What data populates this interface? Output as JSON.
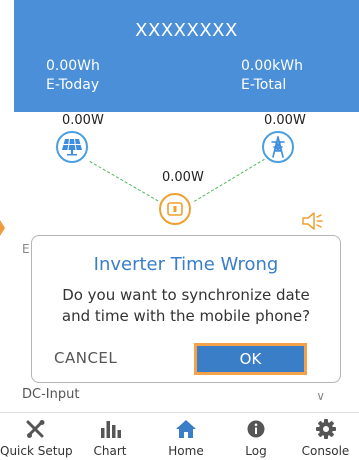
{
  "header": {
    "title": "XXXXXXXX",
    "today_value": "0.00Wh",
    "today_label": "E-Today",
    "total_value": "0.00kWh",
    "total_label": "E-Total"
  },
  "flow": {
    "pv_power": "0.00W",
    "grid_power": "0.00W",
    "inverter_power": "0.00W"
  },
  "dialog": {
    "title": "Inverter Time Wrong",
    "message_line1": "Do you want to synchronize date",
    "message_line2": "and time with the mobile phone?",
    "cancel_label": "CANCEL",
    "ok_label": "OK"
  },
  "partial_label": "E",
  "dc_input": {
    "label": "DC-Input",
    "chevron": "∨"
  },
  "tabbar": {
    "items": [
      {
        "label": "Quick Setup",
        "icon": "tools-icon"
      },
      {
        "label": "Chart",
        "icon": "bar-chart-icon"
      },
      {
        "label": "Home",
        "icon": "home-icon"
      },
      {
        "label": "Log",
        "icon": "info-icon"
      },
      {
        "label": "Console",
        "icon": "gear-icon"
      }
    ]
  },
  "colors": {
    "header_bg": "#4a8fd8",
    "accent_blue": "#3a7ec8",
    "accent_orange": "#f3a24b",
    "flow_green": "#4cba5a"
  }
}
